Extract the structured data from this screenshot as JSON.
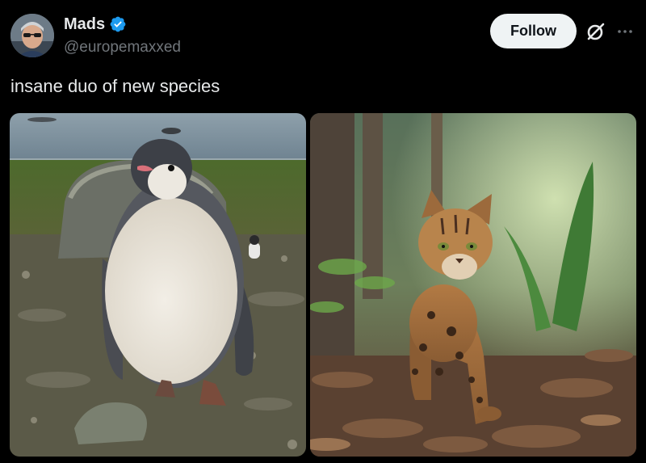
{
  "author": {
    "display_name": "Mads",
    "handle": "@europemaxxed",
    "verified": true,
    "avatar_icon": "profile-photo-avatar"
  },
  "actions": {
    "follow_label": "Follow",
    "grok_icon": "grok-icon",
    "more_icon": "more-options-icon"
  },
  "tweet": {
    "text": "insane duo of new species"
  },
  "media": [
    {
      "alt_icon": "penguin-chick-photo"
    },
    {
      "alt_icon": "wild-cat-photo"
    }
  ],
  "colors": {
    "background": "#000000",
    "primary_text": "#e7e9ea",
    "secondary_text": "#71767b",
    "verified_blue": "#1d9bf0",
    "follow_bg": "#eff3f4"
  }
}
